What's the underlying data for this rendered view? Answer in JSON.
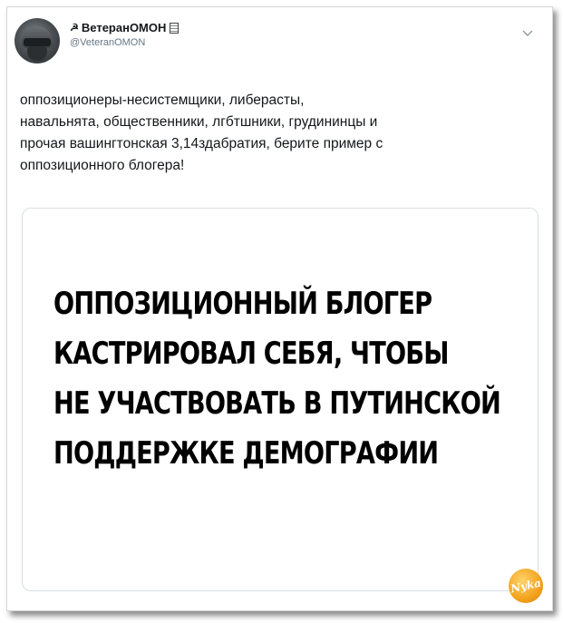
{
  "tweet": {
    "author_prefix": "☭",
    "author_name": "ВетеранОМОН",
    "handle": "@VeteranOMON",
    "text_lines": [
      "оппозиционеры-несистемщики, либерасты,",
      "навальнята, общественники, лгбтшники, грудининцы и",
      "прочая вашингтонская 3,14здабратия, берите пример с",
      "оппозиционного блогера!"
    ]
  },
  "media": {
    "lines": [
      "ОППОЗИЦИОННЫЙ БЛОГЕР",
      "КАСТРИРОВАЛ СЕБЯ, ЧТОБЫ",
      "НЕ УЧАСТВОВАТЬ В ПУТИНСКОЙ",
      "ПОДДЕРЖКЕ ДЕМОГРАФИИ"
    ]
  },
  "watermark": {
    "text": "Nyka",
    "color": "#f3a21c"
  },
  "icons": [
    "avatar",
    "sickle-icon",
    "flag-icon",
    "chevron-down-icon"
  ]
}
